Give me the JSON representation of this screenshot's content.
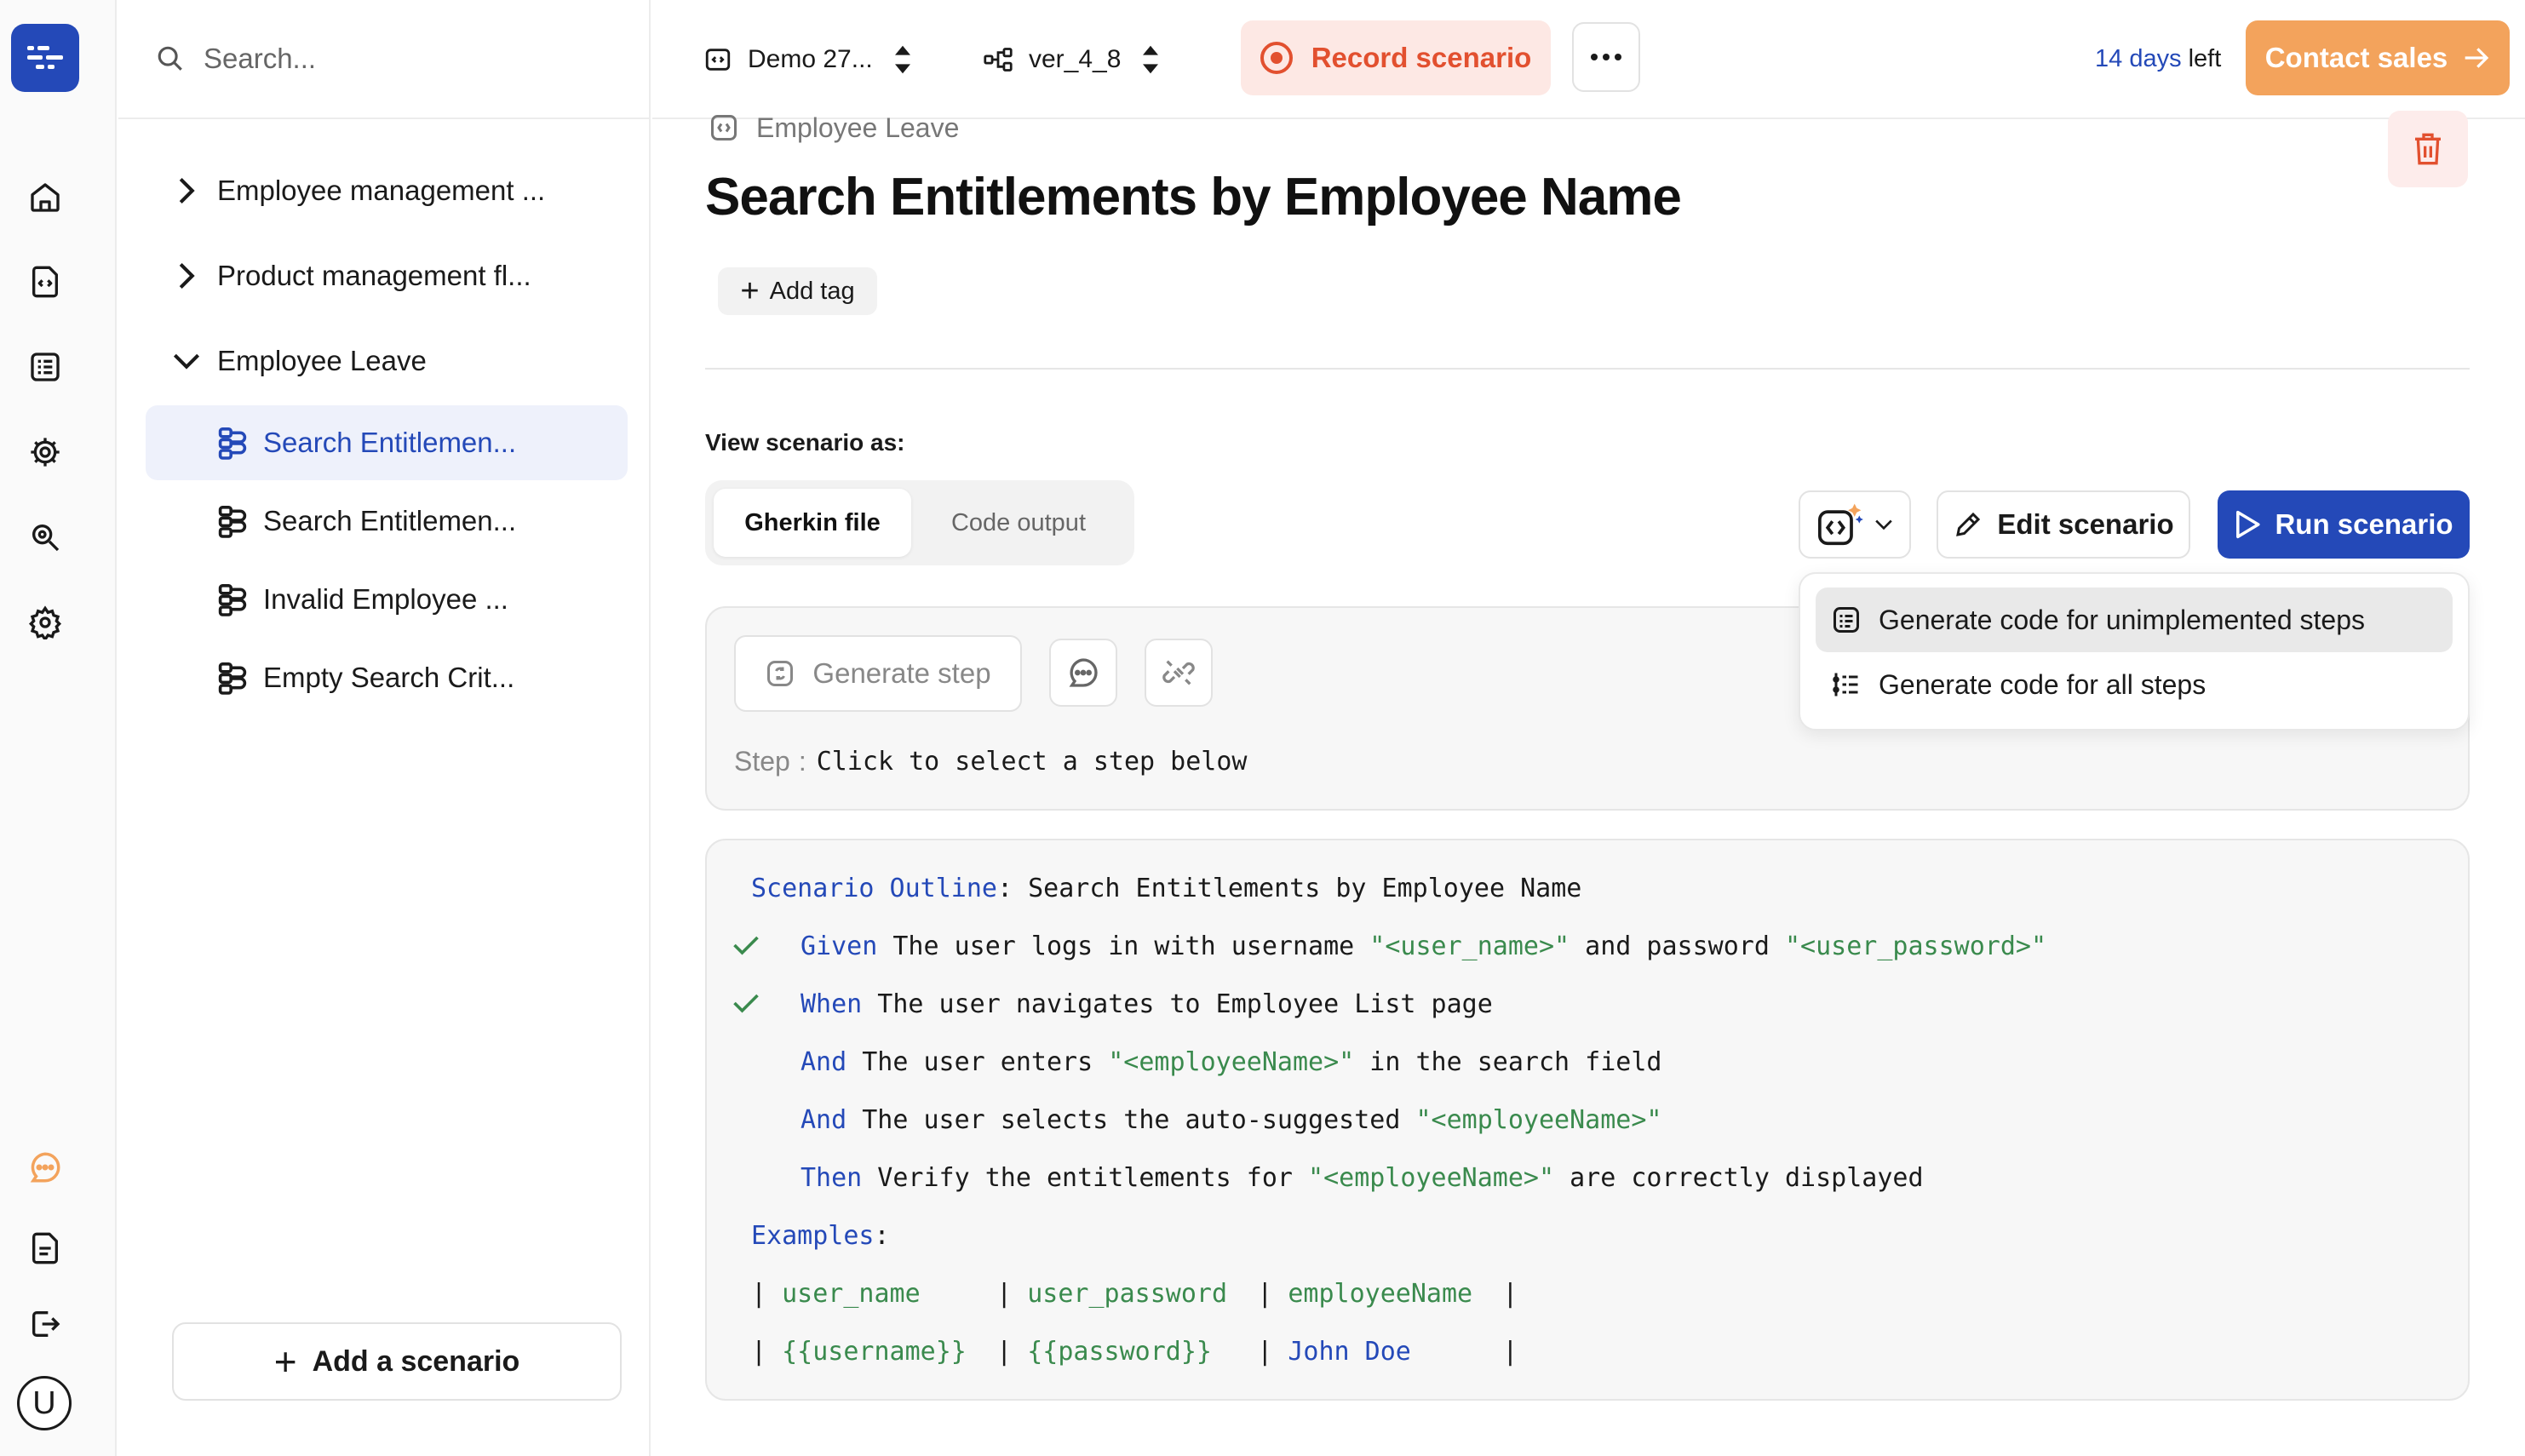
{
  "search": {
    "placeholder": "Search..."
  },
  "tree": {
    "folders": [
      {
        "label": "Employee management ...",
        "expanded": false
      },
      {
        "label": "Product management fl...",
        "expanded": false
      },
      {
        "label": "Employee Leave",
        "expanded": true
      }
    ],
    "items": [
      {
        "label": "Search Entitlemen...",
        "active": true
      },
      {
        "label": "Search Entitlemen...",
        "active": false
      },
      {
        "label": "Invalid Employee ...",
        "active": false
      },
      {
        "label": "Empty Search Crit...",
        "active": false
      }
    ],
    "add_scenario_label": "Add a scenario"
  },
  "topbar": {
    "project": "Demo 27...",
    "version": "ver_4_8",
    "record_label": "Record scenario",
    "trial_days": "14 days",
    "trial_suffix": "left",
    "contact_label": "Contact sales"
  },
  "main": {
    "breadcrumb": "Employee Leave",
    "title": "Search Entitlements by Employee Name",
    "add_tag_label": "Add tag",
    "view_as_label": "View scenario as:",
    "tabs": [
      {
        "label": "Gherkin file",
        "active": true
      },
      {
        "label": "Code output",
        "active": false
      }
    ],
    "edit_label": "Edit scenario",
    "run_label": "Run scenario",
    "generate_step_label": "Generate step",
    "step_label": "Step",
    "step_value": "Click to select a step below"
  },
  "dropdown": {
    "items": [
      {
        "label": "Generate code for unimplemented steps",
        "highlighted": true
      },
      {
        "label": "Generate code for all steps",
        "highlighted": false
      }
    ]
  },
  "gherkin": {
    "outline_kw": "Scenario Outline",
    "outline_name": ": Search Entitlements by Employee Name",
    "steps": [
      {
        "kw": "Given",
        "t1": " The user logs in with username ",
        "s1": "\"<user_name>\"",
        "t2": " and password ",
        "s2": "\"<user_password>\"",
        "t3": "",
        "done": true
      },
      {
        "kw": "When",
        "t1": " The user navigates to Employee List page",
        "s1": "",
        "t2": "",
        "s2": "",
        "t3": "",
        "done": true
      },
      {
        "kw": "And",
        "t1": " The user enters ",
        "s1": "\"<employeeName>\"",
        "t2": " in the search field",
        "s2": "",
        "t3": "",
        "done": false
      },
      {
        "kw": "And",
        "t1": " The user selects the auto-suggested ",
        "s1": "\"<employeeName>\"",
        "t2": "",
        "s2": "",
        "t3": "",
        "done": false
      },
      {
        "kw": "Then",
        "t1": " Verify the entitlements for ",
        "s1": "\"<employeeName>\"",
        "t2": " are correctly displayed",
        "s2": "",
        "t3": "",
        "done": false
      }
    ],
    "examples_kw": "Examples",
    "examples_colon": ":",
    "table": {
      "header": [
        "user_name",
        "user_password",
        "employeeName"
      ],
      "row": [
        "{{username}}",
        "{{password}}",
        "John Doe"
      ]
    }
  },
  "colors": {
    "primary": "#2449b8",
    "record": "#e2502f",
    "contact": "#f3a35c",
    "string": "#3a8a4d",
    "check": "#3a8a4d"
  }
}
